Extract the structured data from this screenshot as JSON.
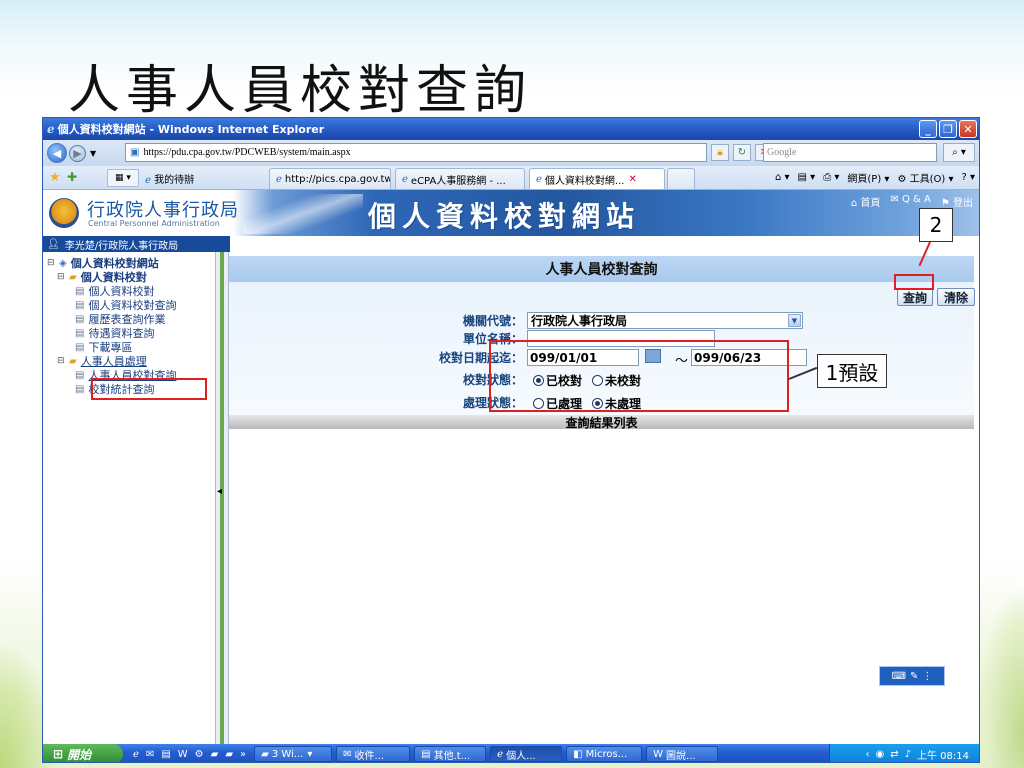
{
  "slide": {
    "title": "人事人員校對查詢"
  },
  "window": {
    "title": "個人資料校對網站 - Windows Internet Explorer"
  },
  "address_bar": {
    "url": "https://pdu.cpa.gov.tw/PDCWEB/system/main.aspx",
    "search_placeholder": "Google"
  },
  "favorites_bar": {
    "my_favorites": "我的待辦"
  },
  "tabs": [
    {
      "label": "http://pics.cpa.gov.tw..."
    },
    {
      "label": "eCPA人事服務網 - ..."
    },
    {
      "label": "個人資料校對網..."
    }
  ],
  "command_bar": {
    "page": "網頁(P)",
    "tools": "工具(O)"
  },
  "site_header": {
    "org_name_cn": "行政院人事行政局",
    "org_name_en": "Central Personnel Administration",
    "site_name": "個人資料校對網站",
    "links": {
      "home": "首頁",
      "qa": "Q & A",
      "logout": "登出"
    }
  },
  "user_strip": {
    "user": "李光楚/行政院人事行政局"
  },
  "tree": {
    "root": "個人資料校對網站",
    "group1": "個人資料校對",
    "items1": [
      "個人資料校對",
      "個人資料校對查詢",
      "履歷表查詢作業",
      "待遇資料查詢",
      "下載專區"
    ],
    "group2": "人事人員處理",
    "items2": [
      "人事人員校對查詢",
      "校對統計查詢"
    ]
  },
  "content": {
    "title": "人事人員校對查詢",
    "query_button": "查詢",
    "clear_button": "清除",
    "labels": {
      "agency_code": "機關代號：",
      "unit_name": "單位名稱：",
      "date_range": "校對日期起迄：",
      "proof_status": "校對狀態：",
      "process_status": "處理狀態："
    },
    "agency_value": "行政院人事行政局",
    "unit_value": "",
    "date_from": "099/01/01",
    "date_to": "099/06/23",
    "tilde": "～",
    "proof_options": {
      "checked": "已校對",
      "unchecked": "未校對"
    },
    "process_options": {
      "processed": "已處理",
      "unprocessed": "未處理"
    },
    "result_header": "查詢結果列表"
  },
  "callouts": {
    "one": "1預設",
    "two": "2"
  },
  "taskbar": {
    "start": "開始",
    "items": [
      "3 Wi...",
      "收件...",
      "其他.t...",
      "個人...",
      "Micros...",
      "圖說..."
    ],
    "clock": "上午 08:14"
  }
}
